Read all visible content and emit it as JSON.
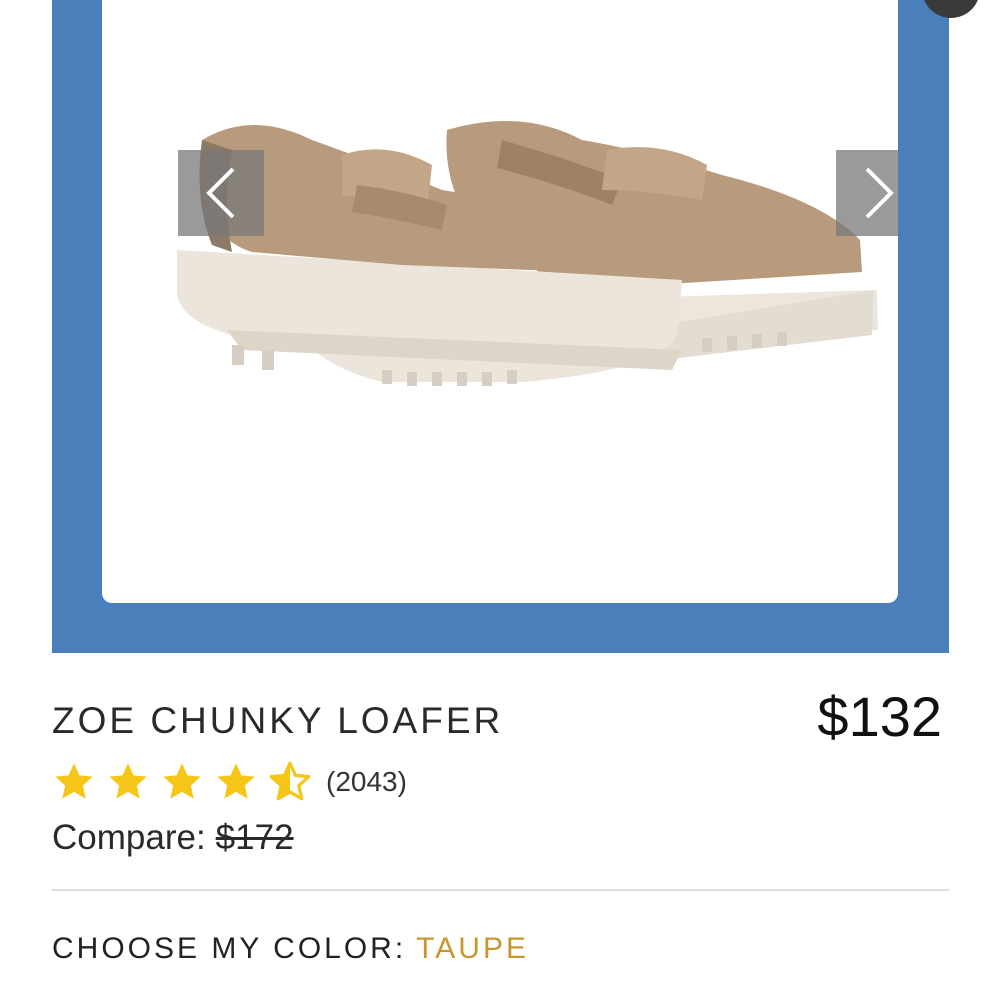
{
  "product": {
    "title": "ZOE CHUNKY LOAFER",
    "price": "$132",
    "rating": {
      "value": 4.5,
      "max": 5,
      "review_count": "(2043)"
    },
    "compare_label": "Compare:",
    "compare_price": "$172"
  },
  "color_picker": {
    "label": "CHOOSE MY COLOR:",
    "selected": "TAUPE"
  },
  "gallery": {
    "prev_icon": "chevron-left-icon",
    "next_icon": "chevron-right-icon"
  },
  "colors": {
    "gallery_bg": "#4a7fbb",
    "star": "#f5c518",
    "accent": "#c9962c",
    "suede": "#b89a7c",
    "sole": "#ebe5db"
  }
}
